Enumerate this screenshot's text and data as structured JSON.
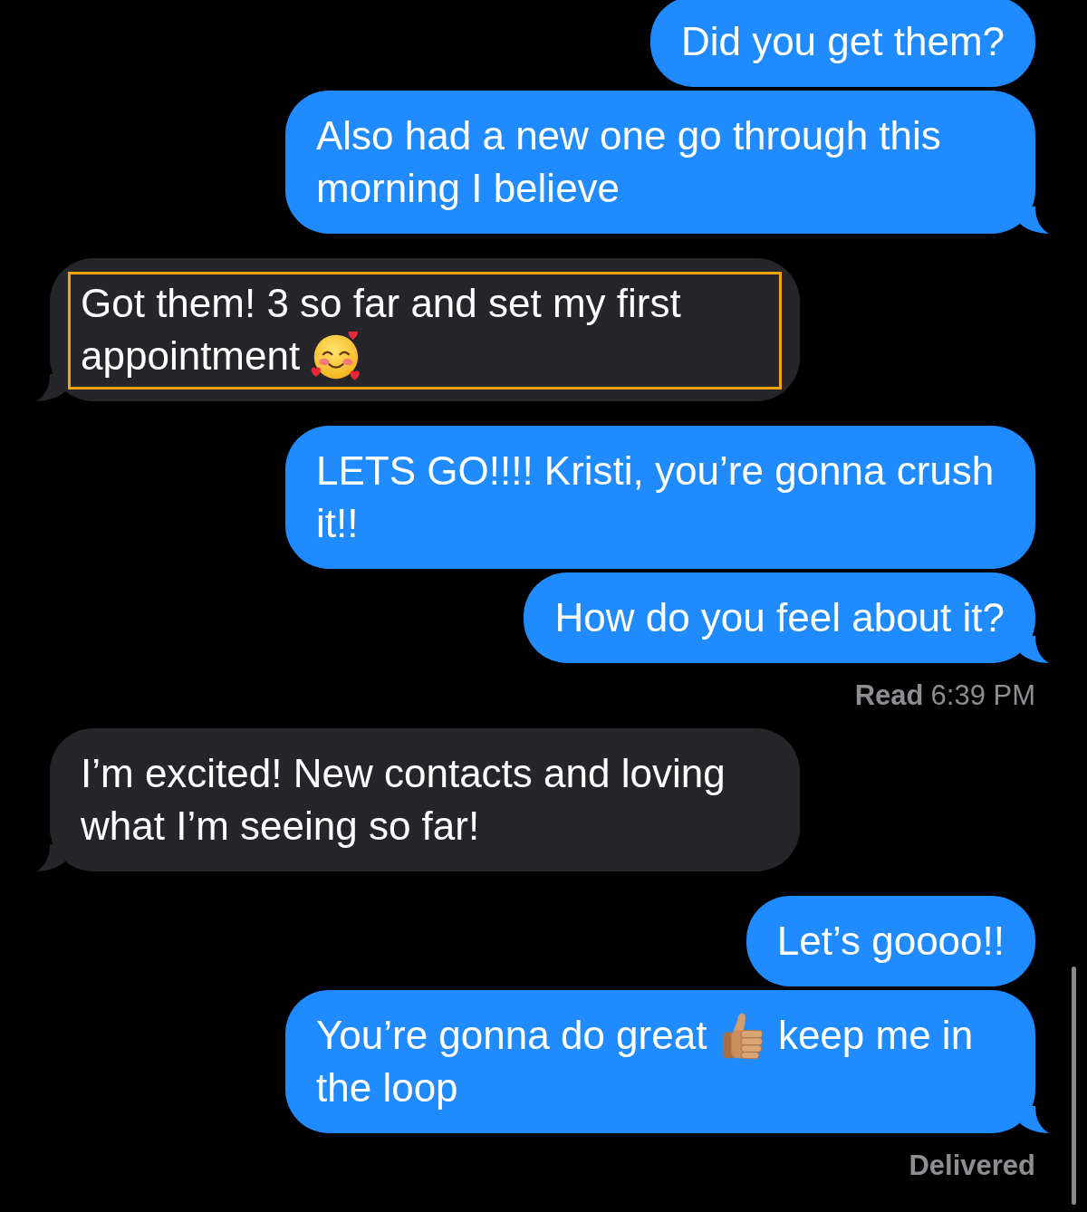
{
  "thread": [
    {
      "kind": "sent",
      "tail": false,
      "highlighted": false,
      "parts": [
        {
          "kind": "text",
          "text": "Did you get them?"
        }
      ]
    },
    {
      "kind": "sent",
      "tail": true,
      "highlighted": false,
      "parts": [
        {
          "kind": "text",
          "text": "Also had a new one go through this morning I believe"
        }
      ]
    },
    {
      "kind": "received",
      "tail": true,
      "highlighted": true,
      "parts": [
        {
          "kind": "text",
          "text": "Got them! 3 so far and set my first appointment"
        },
        {
          "kind": "heartface"
        }
      ]
    },
    {
      "kind": "sent",
      "tail": false,
      "highlighted": false,
      "parts": [
        {
          "kind": "text",
          "text": "LETS GO!!!! Kristi, you’re gonna crush it!!"
        }
      ]
    },
    {
      "kind": "sent",
      "tail": true,
      "highlighted": false,
      "parts": [
        {
          "kind": "text",
          "text": "How do you feel about it?"
        }
      ]
    },
    {
      "kind": "receipt",
      "status": "Read",
      "time": "6:39 PM"
    },
    {
      "kind": "received",
      "tail": true,
      "highlighted": false,
      "parts": [
        {
          "kind": "text",
          "text": "I’m excited! New contacts and loving what I’m seeing so far!"
        }
      ]
    },
    {
      "kind": "sent",
      "tail": false,
      "highlighted": false,
      "parts": [
        {
          "kind": "text",
          "text": "Let’s goooo!!"
        }
      ]
    },
    {
      "kind": "sent",
      "tail": true,
      "highlighted": false,
      "parts": [
        {
          "kind": "text",
          "text": "You’re gonna do great"
        },
        {
          "kind": "thumbsup"
        },
        {
          "kind": "text",
          "text": "keep me in the loop"
        }
      ]
    },
    {
      "kind": "receipt",
      "status": "Delivered"
    }
  ]
}
